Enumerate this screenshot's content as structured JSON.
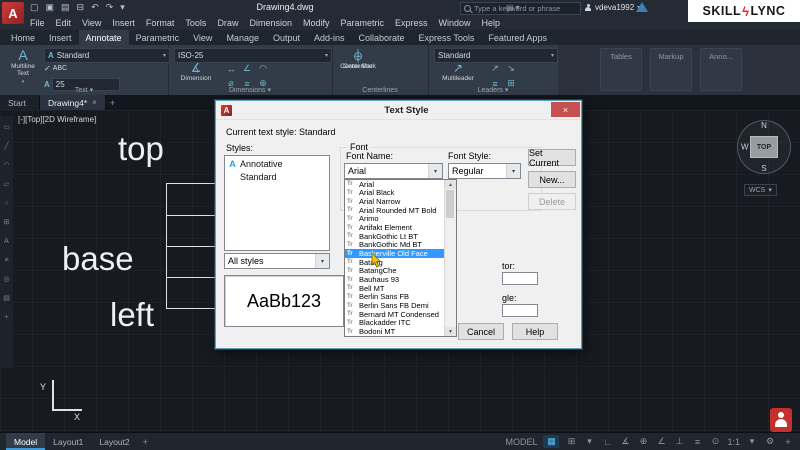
{
  "icons": {
    "dropdown": "▾",
    "up": "▲",
    "down": "▼",
    "close": "×",
    "plus": "+",
    "check": "✓",
    "panel": "▤"
  },
  "titlebar": {
    "logo": "A",
    "title": "Drawing4.dwg",
    "search_placeholder": "Type a keyword or phrase",
    "user": "vdeva1992",
    "brand_left": "SKILL",
    "brand_bolt": "ϟ",
    "brand_right": "LYNC",
    "qat_icons": [
      {
        "n": "new-file-icon",
        "g": "▢"
      },
      {
        "n": "open-file-icon",
        "g": "▣"
      },
      {
        "n": "save-icon",
        "g": "▤"
      },
      {
        "n": "plot-icon",
        "g": "⊟"
      },
      {
        "n": "undo-icon",
        "g": "↶"
      },
      {
        "n": "redo-icon",
        "g": "↷"
      },
      {
        "n": "qat-dropdown-icon",
        "g": "▾"
      }
    ]
  },
  "menubar": {
    "items": [
      "File",
      "Edit",
      "View",
      "Insert",
      "Format",
      "Tools",
      "Draw",
      "Dimension",
      "Modify",
      "Parametric",
      "Express",
      "Window",
      "Help"
    ]
  },
  "ribbon": {
    "tabs": [
      "Home",
      "Insert",
      "Annotate",
      "Parametric",
      "View",
      "Manage",
      "Output",
      "Add-ins",
      "Collaborate",
      "Express Tools",
      "Featured Apps"
    ],
    "active_tab": "Annotate",
    "text_panel": {
      "label": "Text",
      "big_icon": "A",
      "big_label": "Multiline Text",
      "style_icon": "A",
      "style_value": "Standard",
      "spell_label": "ABC",
      "height_value": "25"
    },
    "dim_panel": {
      "label": "Dimensions",
      "style_value": "ISO-25",
      "big_icon": "∡",
      "big_label": "Dimension",
      "icons": [
        {
          "n": "linear-dimension-icon",
          "g": "↔"
        },
        {
          "n": "angular-dimension-icon",
          "g": "∠"
        },
        {
          "n": "arc-length-icon",
          "g": "◠"
        },
        {
          "n": "diameter-dimension-icon",
          "g": "⌀"
        },
        {
          "n": "baseline-dimension-icon",
          "g": "≡"
        },
        {
          "n": "quick-dimension-icon",
          "g": "⊕"
        }
      ]
    },
    "center_panel": {
      "label": "Centerlines",
      "buttons": [
        {
          "n": "center-mark-button",
          "icon": "⊕",
          "label": "Center Mark"
        },
        {
          "n": "centerline-button",
          "icon": "┆",
          "label": "Centerline"
        }
      ]
    },
    "leaders_panel": {
      "label": "Leaders",
      "style_value": "Standard",
      "big_icon": "↗",
      "big_label": "Multileader",
      "icons": [
        {
          "n": "add-leader-icon",
          "g": "↗"
        },
        {
          "n": "remove-leader-icon",
          "g": "↘"
        },
        {
          "n": "align-leaders-icon",
          "g": "≡"
        },
        {
          "n": "collect-leaders-icon",
          "g": "⊞"
        }
      ]
    },
    "collapsed_panels": [
      "Tables",
      "Markup",
      "Anno..."
    ]
  },
  "filetabs": {
    "tabs": [
      {
        "label": "Start"
      },
      {
        "label": "Drawing4*",
        "on": true,
        "close": "×"
      }
    ]
  },
  "canvas": {
    "viewport_label": "[-][Top][2D Wireframe]",
    "text_top": "top",
    "text_base": "base",
    "text_left": "left",
    "viewcube": {
      "n": "N",
      "w": "W",
      "s": "S",
      "top": "TOP"
    },
    "wcs": "WCS",
    "ucs_x": "X",
    "ucs_y": "Y",
    "left_toolbar_icons": [
      {
        "n": "layer-icon",
        "g": "▭"
      },
      {
        "n": "line-icon",
        "g": "╱"
      },
      {
        "n": "arc-icon",
        "g": "◠"
      },
      {
        "n": "polyline-icon",
        "g": "▱"
      },
      {
        "n": "circle-icon",
        "g": "○"
      },
      {
        "n": "rectangle-icon",
        "g": "⊞"
      },
      {
        "n": "text-tool-icon",
        "g": "A"
      },
      {
        "n": "list-icon",
        "g": "≡"
      },
      {
        "n": "center-tool-icon",
        "g": "◎"
      },
      {
        "n": "hatch-icon",
        "g": "▤"
      },
      {
        "n": "plus-tool-icon",
        "g": "+"
      }
    ]
  },
  "dialog": {
    "title": "Text Style",
    "icon": "A",
    "current_label": "Current text style:  Standard",
    "styles_label": "Styles:",
    "styles": [
      {
        "label": "Annotative",
        "icon": "A"
      },
      {
        "label": "Standard",
        "icon": ""
      }
    ],
    "filter_value": "All styles",
    "preview_text": "AaBb123",
    "font_group_label": "Font",
    "font_name_label": "Font Name:",
    "font_style_label": "Font Style:",
    "font_name_value": "Arial",
    "font_style_value": "Regular",
    "tt_icon": "Tr",
    "font_list": [
      "Arial",
      "Arial Black",
      "Arial Narrow",
      "Arial Rounded MT Bold",
      "Arimo",
      "Artifakt Element",
      "BankGothic Lt BT",
      "BankGothic Md BT",
      "Baskerville Old Face",
      "Batang",
      "BatangChe",
      "Bauhaus 93",
      "Bell MT",
      "Berlin Sans FB",
      "Berlin Sans FB Demi",
      "Bernard MT Condensed",
      "Blackadder ITC",
      "Bodoni MT"
    ],
    "selected_font": "Baskerville Old Face",
    "factor_fragment": "tor:",
    "angle_fragment": "gle:",
    "set_current_label": "Set Current",
    "new_label": "New...",
    "delete_label": "Delete",
    "cancel_label": "Cancel",
    "help_label": "Help"
  },
  "statusbar": {
    "layout_tabs": [
      {
        "label": "Model",
        "on": true
      },
      {
        "label": "Layout1"
      },
      {
        "label": "Layout2"
      }
    ],
    "icons": [
      {
        "n": "model-space-label",
        "g": "MODEL"
      },
      {
        "n": "grid-icon",
        "g": "▦",
        "on": true
      },
      {
        "n": "snap-mode-icon",
        "g": "⊞"
      },
      {
        "n": "snap-dropdown-icon",
        "g": "▾"
      },
      {
        "n": "ortho-icon",
        "g": "∟"
      },
      {
        "n": "polar-tracking-icon",
        "g": "∡"
      },
      {
        "n": "isodraft-icon",
        "g": "⊕"
      },
      {
        "n": "osnap-icon",
        "g": "∠"
      },
      {
        "n": "object-snap-icon",
        "g": "⊥"
      },
      {
        "n": "lineweight-icon",
        "g": "≡"
      },
      {
        "n": "selection-cycling-icon",
        "g": "⊙"
      },
      {
        "n": "annotation-scale-label",
        "g": "1:1"
      },
      {
        "n": "scale-dropdown-icon",
        "g": "▾"
      },
      {
        "n": "gear-icon",
        "g": "⚙"
      },
      {
        "n": "customize-plus-icon",
        "g": "+"
      }
    ]
  }
}
